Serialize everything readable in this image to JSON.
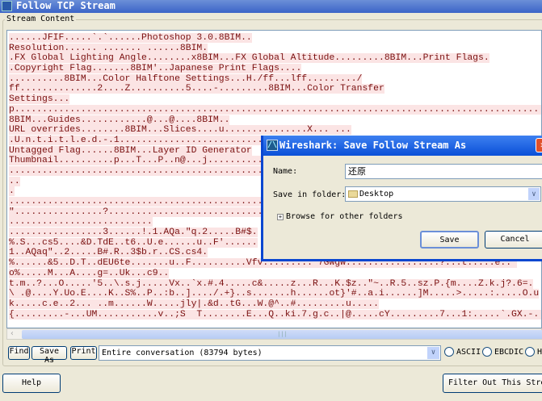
{
  "window": {
    "title": "Follow TCP Stream"
  },
  "group_label": "Stream Content",
  "stream_lines": [
    "......JFIF.....`.`......Photoshop 3.0.8BIM..",
    "Resolution...... ....... ......8BIM.",
    ".FX Global Lighting Angle........x8BIM...FX Global Altitude.........8BIM...Print Flags.",
    ".Copyright Flag.......8BIM'..Japanese Print Flags....",
    "..........8BIM...Color Halftone Settings...H./ff...lff........./",
    "ff..............2....Z..........5....-.........8BIM...Color Transfer",
    "Settings...",
    "p.................................................................................................",
    "8BIM...Guides............@...@....8BIM..",
    "URL overrides........8BIM...Slices....u...............X... ...",
    ".U.n.t.i.t.l.e.d.-.1.....................................",
    "Untagged Flag......8BIM...Layer ID Generator",
    "Thumbnail..........p...T...P..n@...j..........",
    "..................................................",
    "..",
    ".",
    "..................................................",
    "\"................?.................................",
    "..........................",
    ".................3......!.1.AQa.\"q.2.....B#$.",
    "%.S...cs5....&D.TdE..t6..U.e......u..F'......",
    "1..AQaq\"..2.....B#.R..3$b.r..CS.cs4.",
    "%......&5..D.T..dEU6te.......u..F..........Vfv.........'7GWgw.................?...t.....e..'",
    "o%.....M...A....g=..Uk...c9..",
    "t.m..?...O.....'5..\\.s.j.....Vx..`x.#.4.....c&.....z...R...K.$z..\"~..R.5..sz.P.{m....Z.k.j?.6=.",
    "\\ .@....Y.Uo.E....K..S%..P..:b..]..../.+}..s.......h......ot}'#..a.i......]M.....>.....:.....O.u",
    "k.....c.e..2... ..m......W.....jly|.&d..tG...W.@^..#.........u.....",
    "{.........-...UM...........v..;S  T........E...Q..ki.7.g.c..|@.....cY.........7...1:.....`.GX.-.."
  ],
  "toolbar": {
    "find": "Find",
    "save_as": "Save As",
    "print": "Print",
    "conversation": "Entire conversation (83794 bytes)",
    "radio_ascii": "ASCII",
    "radio_ebcdic": "EBCDIC",
    "radio_hex": "H"
  },
  "footer": {
    "help": "Help",
    "filter_out": "Filter Out This Stream"
  },
  "dialog": {
    "title": "Wireshark: Save Follow Stream As",
    "name_label": "Name:",
    "name_value": "还原",
    "folder_label": "Save in folder:",
    "folder_value": "Desktop",
    "browse": "Browse for other folders",
    "save": "Save",
    "cancel": "Cancel"
  },
  "colors": {
    "text": "#7a1010",
    "highlight": "#fbe4e4",
    "title_blue": "#0a50d8"
  }
}
